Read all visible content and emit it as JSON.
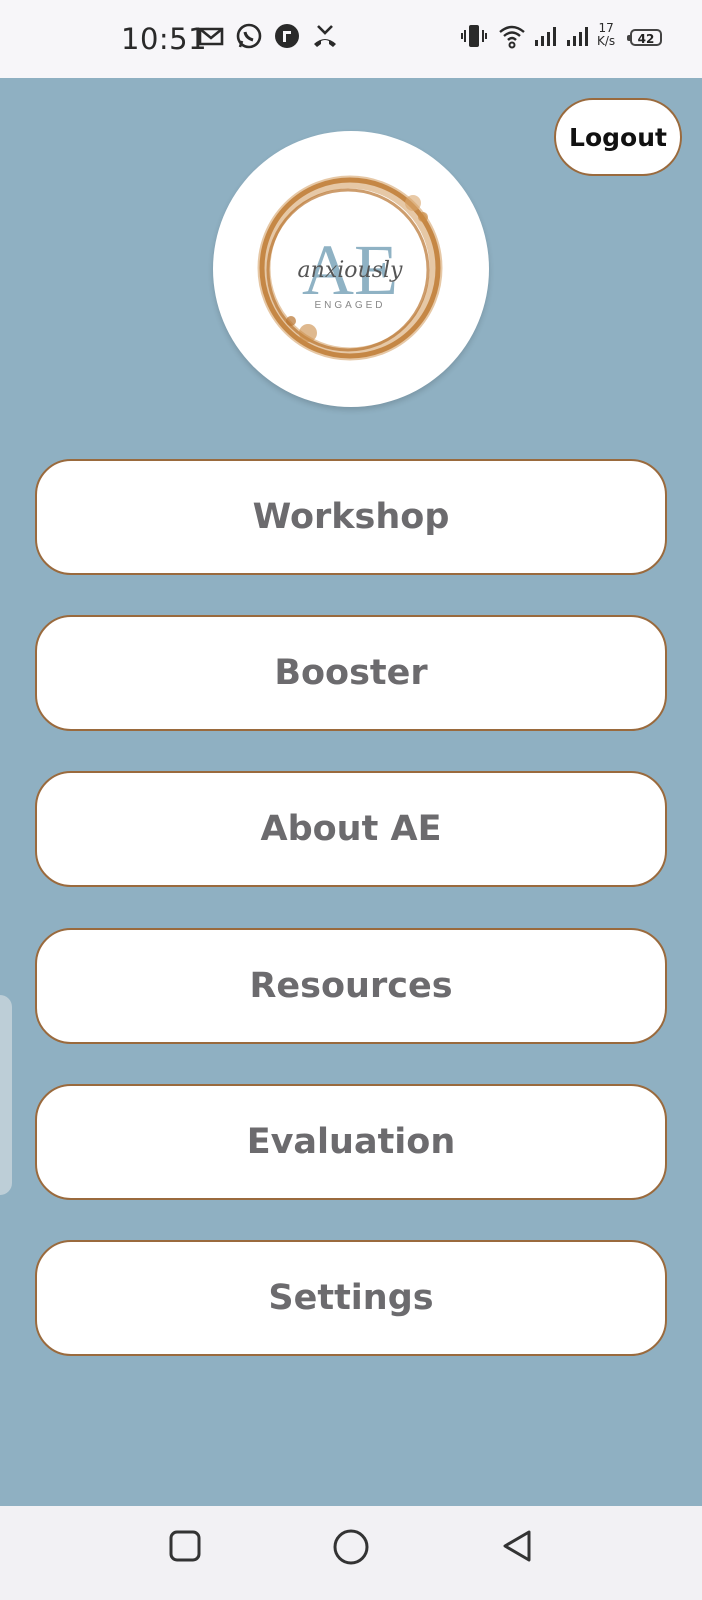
{
  "status_bar": {
    "time": "10:51",
    "network_speed_value": "17",
    "network_speed_unit": "K/s",
    "battery_level": "42",
    "icons": [
      "gmail-icon",
      "whatsapp-icon",
      "app-notification-icon",
      "missed-call-icon",
      "vibrate-icon",
      "wifi-icon",
      "signal-icon",
      "signal-icon"
    ]
  },
  "header": {
    "logout_label": "Logout"
  },
  "logo": {
    "monogram": "AE",
    "script_text": "anxiously",
    "subtitle": "ENGAGED",
    "ring_color": "#c98a45"
  },
  "menu": {
    "items": [
      {
        "label": "Workshop"
      },
      {
        "label": "Booster"
      },
      {
        "label": "About AE"
      },
      {
        "label": "Resources"
      },
      {
        "label": "Evaluation"
      },
      {
        "label": "Settings"
      }
    ]
  },
  "nav_bar": {
    "icons": [
      "recents-square-icon",
      "home-circle-icon",
      "back-triangle-icon"
    ]
  },
  "colors": {
    "background": "#8fb0c2",
    "button_border": "#9a6a3d",
    "button_text": "#6c6b6e",
    "monogram": "#8fb2c4"
  }
}
